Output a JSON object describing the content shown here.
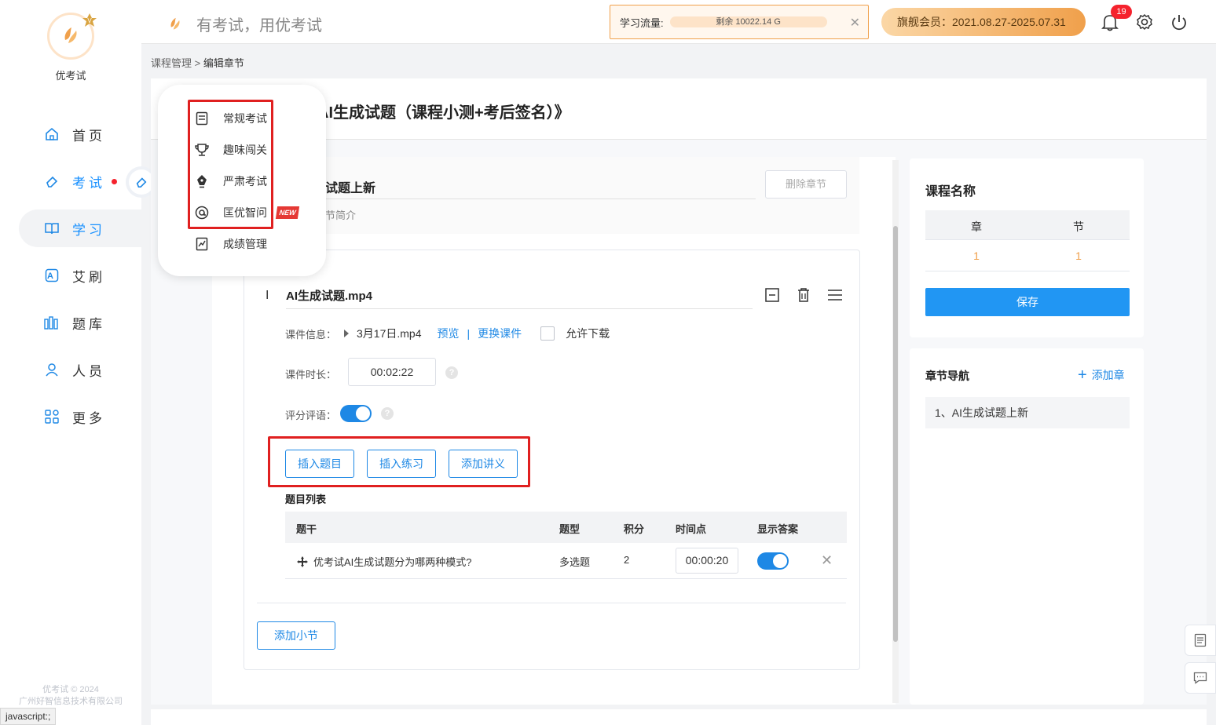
{
  "app": {
    "name": "优考试",
    "slogan": "有考试，用优考试",
    "copyright_line1": "优考试 © 2024",
    "copyright_line2": "广州好智信息技术有限公司",
    "status_text": "javascript:;"
  },
  "sidebar": {
    "items": [
      {
        "label": "首页",
        "icon": "home-icon"
      },
      {
        "label": "考试",
        "icon": "eraser-icon"
      },
      {
        "label": "学习",
        "icon": "book-icon"
      },
      {
        "label": "艾刷",
        "icon": "ai-icon"
      },
      {
        "label": "题库",
        "icon": "library-icon"
      },
      {
        "label": "人员",
        "icon": "user-icon"
      },
      {
        "label": "更多",
        "icon": "apps-icon"
      }
    ]
  },
  "topbar": {
    "traffic_label": "学习流量:",
    "traffic_value": "剩余 10022.14 G",
    "vip_text": "旗舰会员：2021.08.27-2025.07.31",
    "notification_count": "19"
  },
  "breadcrumb": {
    "parent": "课程管理",
    "separator": ">",
    "current": "编辑章节"
  },
  "page_title": "AI生成试题（课程小测+考后签名）》",
  "exam_menu": {
    "items": [
      {
        "label": "常规考试",
        "icon": "document-icon"
      },
      {
        "label": "趣味闯关",
        "icon": "trophy-icon"
      },
      {
        "label": "严肃考试",
        "icon": "pen-nib-icon"
      },
      {
        "label": "匡优智问",
        "icon": "ai-chat-icon"
      },
      {
        "label": "成绩管理",
        "icon": "chart-icon"
      }
    ],
    "new_tag": "NEW"
  },
  "chapter": {
    "name": "试题上新",
    "desc_placeholder": "节简介",
    "delete_label": "删除章节"
  },
  "lesson": {
    "index_mark": "I",
    "title": "AI生成试题.mp4",
    "info_label": "课件信息：",
    "file_name": "3月17日.mp4",
    "preview_label": "预览",
    "replace_label": "更换课件",
    "allow_download_label": "允许下载",
    "duration_label": "课件时长：",
    "duration_value": "00:02:22",
    "rating_label": "评分评语：",
    "rating_enabled": true,
    "buttons": [
      "插入题目",
      "插入练习",
      "添加讲义"
    ],
    "question_list_title": "题目列表",
    "columns": [
      "题干",
      "题型",
      "积分",
      "时间点",
      "显示答案"
    ],
    "questions": [
      {
        "stem": "优考试AI生成试题分为哪两种模式?",
        "type": "多选题",
        "score": "2",
        "time": "00:00:20",
        "show_answer": true
      }
    ],
    "add_lesson_label": "添加小节"
  },
  "right_panel": {
    "course_name_title": "课程名称",
    "table_headers": [
      "章",
      "节"
    ],
    "table_values": [
      "1",
      "1"
    ],
    "save_label": "保存",
    "nav_title": "章节导航",
    "add_chapter_label": "添加章",
    "nav_items": [
      "1、AI生成试题上新"
    ]
  },
  "colors": {
    "primary": "#1e88e5",
    "accent_orange": "#f0a04b",
    "highlight_red": "#e02020"
  }
}
